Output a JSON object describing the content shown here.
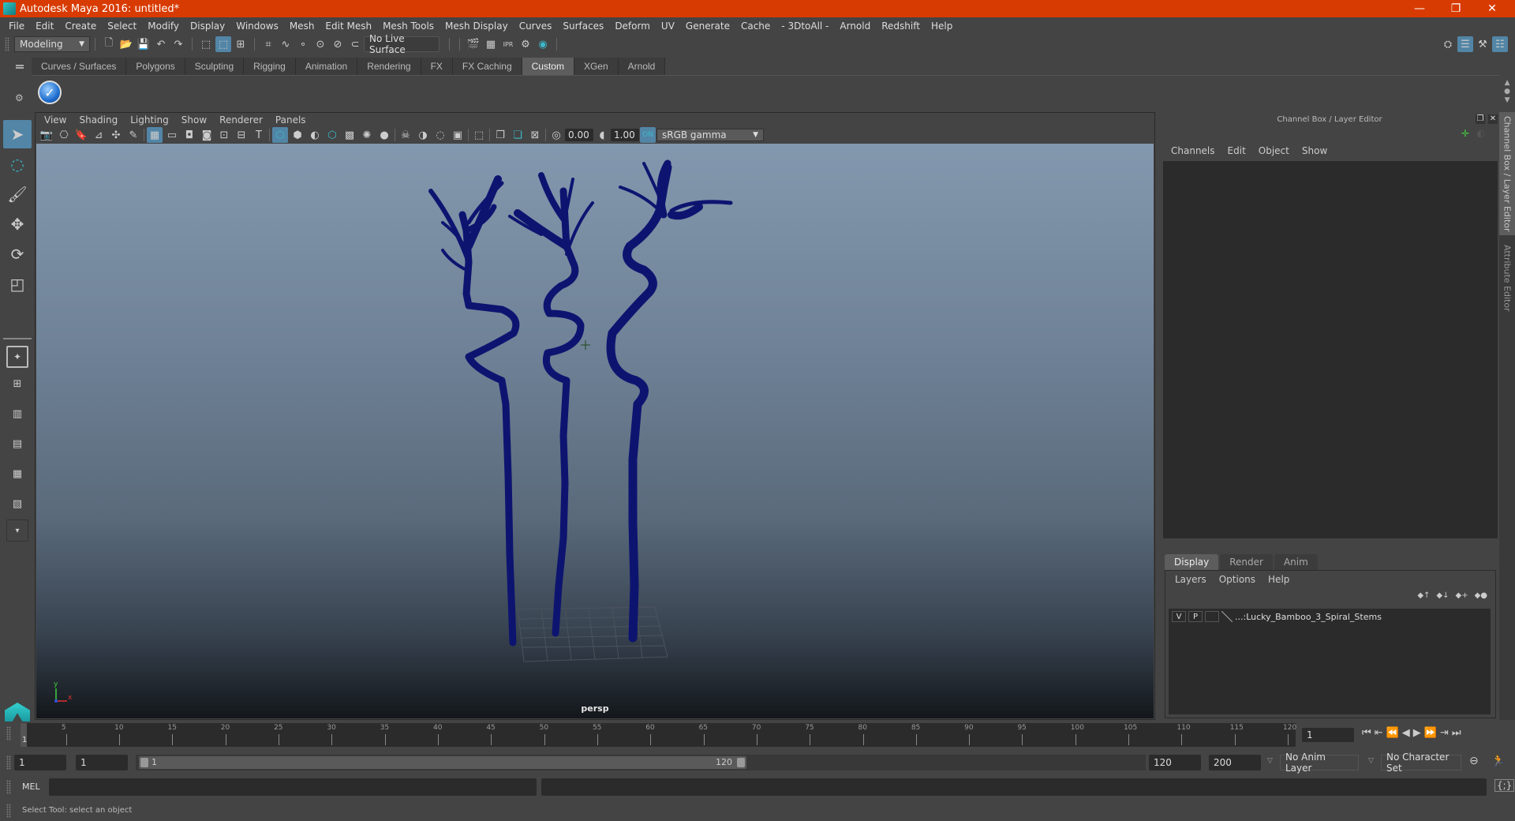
{
  "window": {
    "title": "Autodesk Maya 2016: untitled*",
    "controls": {
      "minimize": "—",
      "restore": "❐",
      "close": "✕"
    }
  },
  "menubar": {
    "items": [
      "File",
      "Edit",
      "Create",
      "Select",
      "Modify",
      "Display",
      "Windows",
      "Mesh",
      "Edit Mesh",
      "Mesh Tools",
      "Mesh Display",
      "Curves",
      "Surfaces",
      "Deform",
      "UV",
      "Generate",
      "Cache",
      "- 3DtoAll -",
      "Arnold",
      "Redshift",
      "Help"
    ]
  },
  "statusline": {
    "mode": "Modeling",
    "live_surface": "No Live Surface"
  },
  "shelf": {
    "tabs": [
      "Curves / Surfaces",
      "Polygons",
      "Sculpting",
      "Rigging",
      "Animation",
      "Rendering",
      "FX",
      "FX Caching",
      "Custom",
      "XGen",
      "Arnold"
    ],
    "active_tab": "Custom"
  },
  "viewport": {
    "menu": [
      "View",
      "Shading",
      "Lighting",
      "Show",
      "Renderer",
      "Panels"
    ],
    "exposure": "0.00",
    "gamma": "1.00",
    "color_space": "sRGB gamma",
    "camera_label": "persp",
    "axis": {
      "x": "x",
      "y": "y"
    },
    "model_color": "#0d1470",
    "background_top": "#8398ae",
    "background_bottom": "#13171b"
  },
  "channel_box": {
    "title": "Channel Box / Layer Editor",
    "menu": [
      "Channels",
      "Edit",
      "Object",
      "Show"
    ],
    "layer_tabs": [
      "Display",
      "Render",
      "Anim"
    ],
    "active_layer_tab": "Display",
    "layer_menu": [
      "Layers",
      "Options",
      "Help"
    ],
    "layers": [
      {
        "visible": "V",
        "playback": "P",
        "name": "...:Lucky_Bamboo_3_Spiral_Stems"
      }
    ]
  },
  "side_tabs": [
    "Channel Box / Layer Editor",
    "Attribute Editor"
  ],
  "timeline": {
    "ticks": [
      "5",
      "10",
      "15",
      "20",
      "25",
      "30",
      "35",
      "40",
      "45",
      "50",
      "55",
      "60",
      "65",
      "70",
      "75",
      "80",
      "85",
      "90",
      "95",
      "100",
      "105",
      "110",
      "115",
      "120"
    ],
    "current_frame_marker": "1",
    "current_frame": "1",
    "range_start": 1,
    "range_end": 120
  },
  "range_slider": {
    "start_time": "1",
    "playback_start": "1",
    "slider_start_label": "1",
    "slider_end_label": "120",
    "playback_end": "120",
    "end_time": "200",
    "anim_layer": "No Anim Layer",
    "character_set": "No Character Set"
  },
  "command_line": {
    "label": "MEL",
    "value": ""
  },
  "help_line": {
    "text": "Select Tool: select an object"
  },
  "accent_colors": {
    "title_bar": "#d83b01",
    "active_tool": "#5285a6",
    "icon_teal": "#3bb8c9",
    "playback_orange": "#e07b39"
  }
}
